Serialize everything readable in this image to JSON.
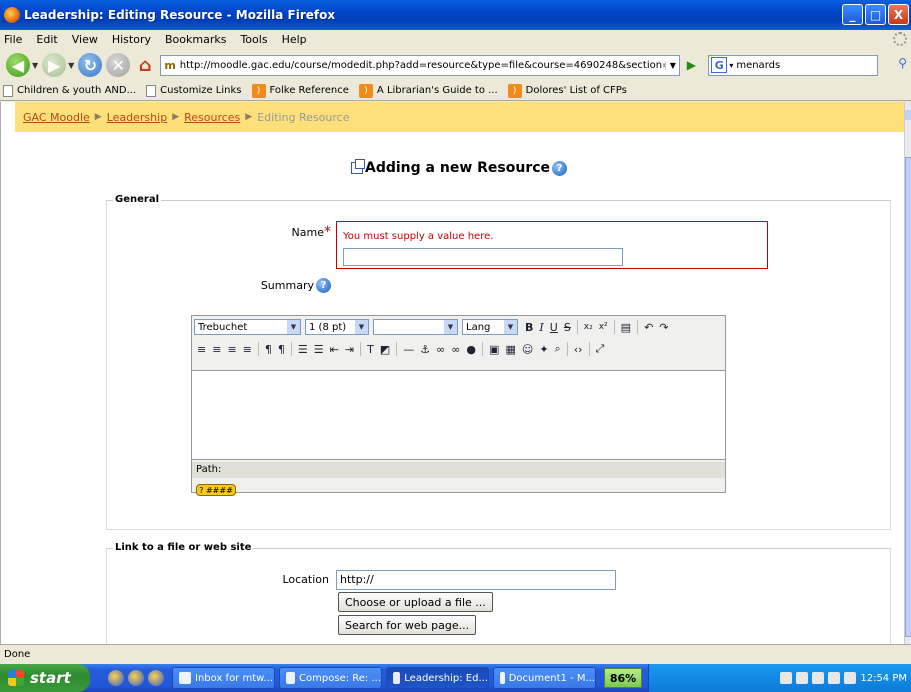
{
  "window": {
    "title": "Leadership: Editing Resource - Mozilla Firefox",
    "buttons": {
      "minimize": "_",
      "maximize": "□",
      "close": "X"
    }
  },
  "menu": [
    "File",
    "Edit",
    "View",
    "History",
    "Bookmarks",
    "Tools",
    "Help"
  ],
  "nav": {
    "url": "http://moodle.gac.edu/course/modedit.php?add=resource&type=file&course=4690248&section=0&return=(",
    "search_engine": "G",
    "search_value": "menards"
  },
  "bookmarks": [
    {
      "label": "Children & youth AND...",
      "type": "page"
    },
    {
      "label": "Customize Links",
      "type": "page"
    },
    {
      "label": "Folke Reference",
      "type": "rss"
    },
    {
      "label": "A Librarian's Guide to ...",
      "type": "rss"
    },
    {
      "label": "Dolores' List of CFPs",
      "type": "rss"
    }
  ],
  "breadcrumb": {
    "items": [
      "GAC Moodle",
      "Leadership",
      "Resources"
    ],
    "current": "Editing Resource",
    "separator": "▶"
  },
  "page": {
    "heading": "Adding a new Resource",
    "help_glyph": "?"
  },
  "general": {
    "legend": "General",
    "name_label": "Name",
    "required_mark": "*",
    "error": "You must supply a value here.",
    "name_value": "",
    "summary_label": "Summary"
  },
  "editor": {
    "font": "Trebuchet",
    "size": "1 (8 pt)",
    "style": "",
    "lang": "Lang",
    "path_label": "Path:",
    "help_label": "? ####"
  },
  "link": {
    "legend": "Link to a file or web site",
    "location_label": "Location",
    "location_value": "http://",
    "choose_button": "Choose or upload a file ...",
    "search_button": "Search for web page..."
  },
  "status": "Done",
  "taskbar": {
    "start": "start",
    "items": [
      {
        "label": "Inbox for mtw...",
        "active": false
      },
      {
        "label": "Compose: Re: ...",
        "active": false
      },
      {
        "label": "Leadership: Ed...",
        "active": true
      },
      {
        "label": "Document1 - M...",
        "active": false
      }
    ],
    "zoom": "86%",
    "clock": "12:54 PM"
  }
}
